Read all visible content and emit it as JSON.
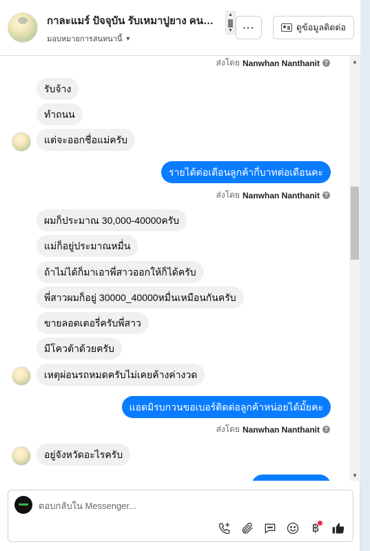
{
  "header": {
    "title": "กาละแมร์ ปัจจุบัน รับเหมาปูยาง คนทำ...",
    "subtitle": "มอบหมายการสนทนานี้",
    "more_label": "···",
    "contact_label": "ดูข้อมูลติดต่อ"
  },
  "messages": {
    "m1": {
      "sent_by": "ส่งโดย",
      "sender": "Nanwhan Nanthanit"
    },
    "m2": "รับจ้าง",
    "m3": "ทำถนน",
    "m4": "แต่จะออกชื่อแม่ครับ",
    "m5": "รายได้ต่อเดือนลูกค้ากี่บาทต่อเดือนคะ",
    "m6": {
      "sent_by": "ส่งโดย",
      "sender": "Nanwhan Nanthanit"
    },
    "m7": "ผมก็ประมาณ 30,000-40000ครับ",
    "m8": "แม่ก็อยู่ประมาณหมื่น",
    "m9": "ถ้าไม่ได้ก็มาเอาพี่สาวออกให้ก็ได้ครับ",
    "m10": "พี่สาวผมก็อยู่ 30000_40000หมื่นเหมือนกันครับ",
    "m11": "ขายลอตเตอรี่ครับพี่สาว",
    "m12": "มีโควต้าด้วยครับ",
    "m13": "เหตุผ่อนรถหมดครับไม่เคยค้างค่างวด",
    "m14": "แอดมิรบกวนขอเบอร์ติดต่อลูกค้าหน่อยได้มั้ยคะ",
    "m15": {
      "sent_by": "ส่งโดย",
      "sender": "Nanwhan Nanthanit"
    },
    "m16": "อยู่จังหวัดอะไรครับ"
  },
  "composer": {
    "placeholder": "ตอบกลับใน Messenger...",
    "tools": [
      "phone-plus-icon",
      "paperclip-icon",
      "saved-replies-icon",
      "emoji-icon",
      "baht-payment-icon",
      "thumbs-up-icon"
    ],
    "baht_symbol": "฿"
  },
  "colors": {
    "outgoing": "#0a7cff",
    "incoming": "#f0f0f0",
    "notify_dot": "#f02849"
  }
}
